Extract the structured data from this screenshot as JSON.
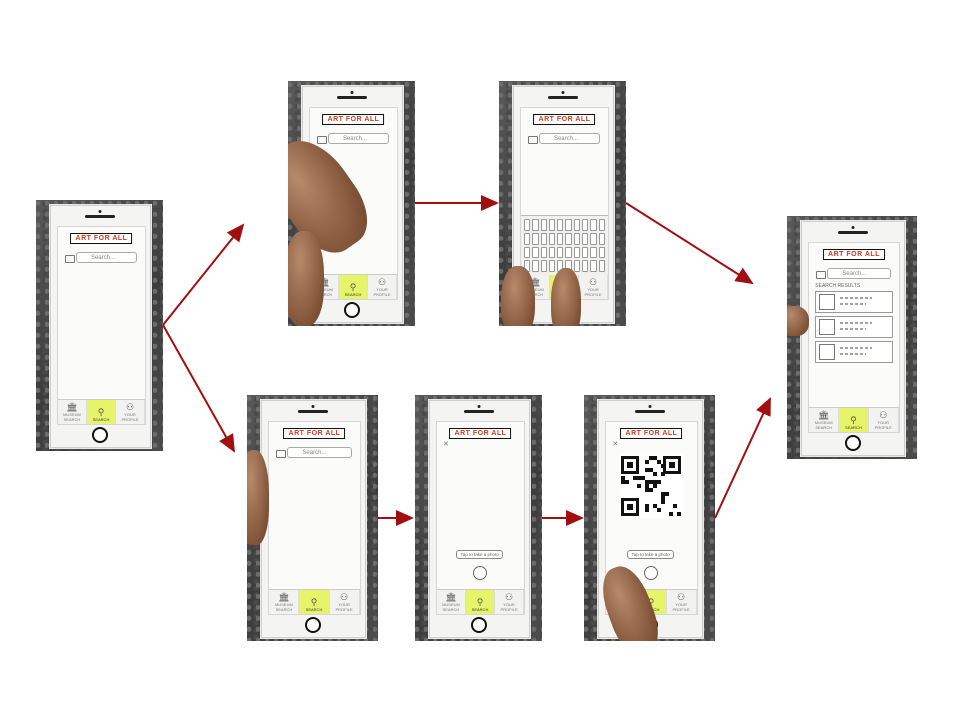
{
  "app_title": "ART FOR ALL",
  "search_placeholder": "Search...",
  "tabs": [
    "MUSEUM SEARCH",
    "SEARCH",
    "YOUR PROFILE"
  ],
  "results_header": "SEARCH RESULTS",
  "tip_text": "Tap to take a photo",
  "colors": {
    "arrow": "#a01010",
    "title_text": "#d23a1a",
    "active_tab": "#e6f46a"
  },
  "screens": [
    {
      "id": "start",
      "state": "search-home"
    },
    {
      "id": "tap-search",
      "state": "finger-on-search-bar"
    },
    {
      "id": "keyboard",
      "state": "typing-on-keyboard"
    },
    {
      "id": "results",
      "state": "search-results"
    },
    {
      "id": "tap-camera",
      "state": "finger-on-camera-icon"
    },
    {
      "id": "camera",
      "state": "camera-view"
    },
    {
      "id": "scan-qr",
      "state": "scanning-qr-code"
    }
  ]
}
